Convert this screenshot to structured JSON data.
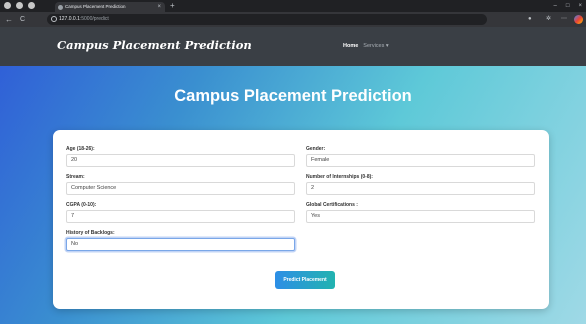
{
  "browser": {
    "tab_title": "Campus Placement Prediction",
    "tab_close": "×",
    "new_tab": "+",
    "url_host": "127.0.0.1",
    "url_path": ":5000/predict",
    "back": "←",
    "reload": "C",
    "min": "–",
    "max": "□",
    "close": "×"
  },
  "nav": {
    "brand": "Campus Placement Prediction",
    "home": "Home",
    "services": "Services ▾"
  },
  "hero": {
    "title": "Campus Placement Prediction"
  },
  "form": {
    "age": {
      "label": "Age (18-26):",
      "value": "20"
    },
    "gender": {
      "label": "Gender:",
      "value": "Female"
    },
    "stream": {
      "label": "Stream:",
      "value": "Computer Science"
    },
    "internships": {
      "label": "Number of Internships (0-8):",
      "value": "2"
    },
    "cgpa": {
      "label": "CGPA (0-10):",
      "value": "7"
    },
    "certifications": {
      "label": "Global Certifications :",
      "value": "Yes"
    },
    "backlogs": {
      "label": "History of Backlogs:",
      "value": "No"
    },
    "submit": "Predict Placement"
  }
}
